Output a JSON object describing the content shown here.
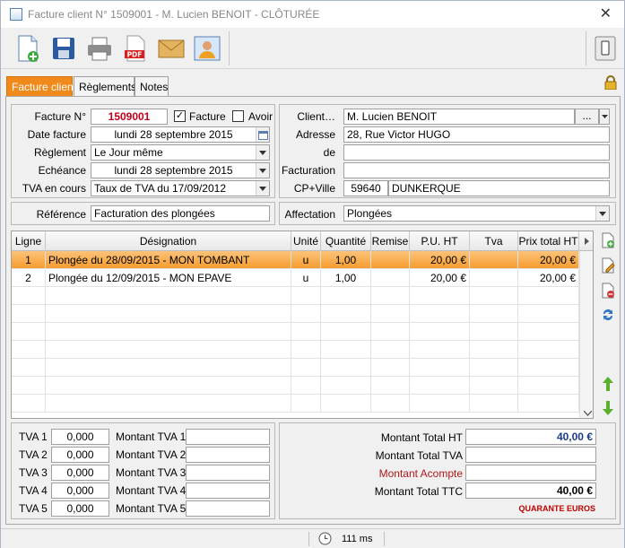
{
  "window": {
    "title": "Facture client N° 1509001 - M. Lucien BENOIT - CLÔTURÉE",
    "close_glyph": "✕"
  },
  "toolbar": {
    "buttons": [
      "new-document-icon",
      "save-icon",
      "print-icon",
      "pdf-icon",
      "email-icon",
      "contact-icon"
    ],
    "pdf_label": "PDF"
  },
  "tabs": [
    {
      "label": "Facture client",
      "active": true
    },
    {
      "label": "Règlements",
      "active": false
    },
    {
      "label": "Notes",
      "active": false
    }
  ],
  "invoice": {
    "number_label": "Facture N°",
    "number": "1509001",
    "facture_label": "Facture",
    "facture_checked": true,
    "avoir_label": "Avoir",
    "avoir_checked": false,
    "date_label": "Date facture",
    "date": "lundi 28 septembre 2015",
    "reglement_label": "Règlement",
    "reglement": "Le Jour même",
    "echeance_label": "Echéance",
    "echeance": "lundi 28 septembre 2015",
    "tva_label": "TVA en cours",
    "tva": "Taux de TVA du 17/09/2012",
    "reference_label": "Référence",
    "reference": "Facturation des plongées"
  },
  "client": {
    "client_label": "Client…",
    "client": "M. Lucien BENOIT",
    "more_button": "...",
    "adresse_label": "Adresse",
    "adresse": "28, Rue Victor HUGO",
    "de_label": "de",
    "de": "",
    "facturation_label": "Facturation",
    "facturation": "",
    "cpville_label": "CP+Ville",
    "cp": "59640",
    "ville": "DUNKERQUE",
    "affectation_label": "Affectation",
    "affectation": "Plongées"
  },
  "grid": {
    "columns": [
      "Ligne",
      "Désignation",
      "Unité",
      "Quantité",
      "Remise",
      "P.U. HT",
      "Tva",
      "Prix total HT"
    ],
    "rows": [
      [
        "1",
        "Plongée du 28/09/2015 - MON TOMBANT",
        "u",
        "1,00",
        "",
        "20,00 €",
        "",
        "20,00 €"
      ],
      [
        "2",
        "Plongée du 12/09/2015 - MON EPAVE",
        "u",
        "1,00",
        "",
        "20,00 €",
        "",
        "20,00 €"
      ]
    ],
    "selected_row": 0,
    "empty_rows": 7
  },
  "tva_summary": [
    {
      "label": "TVA 1",
      "rate": "0,000",
      "amount_label": "Montant TVA 1",
      "amount": ""
    },
    {
      "label": "TVA 2",
      "rate": "0,000",
      "amount_label": "Montant TVA 2",
      "amount": ""
    },
    {
      "label": "TVA 3",
      "rate": "0,000",
      "amount_label": "Montant TVA 3",
      "amount": ""
    },
    {
      "label": "TVA 4",
      "rate": "0,000",
      "amount_label": "Montant TVA 4",
      "amount": ""
    },
    {
      "label": "TVA 5",
      "rate": "0,000",
      "amount_label": "Montant TVA 5",
      "amount": ""
    }
  ],
  "totals": {
    "ht_label": "Montant Total HT",
    "ht": "40,00 €",
    "tva_label": "Montant Total TVA",
    "tva": "",
    "acompte_label": "Montant Acompte",
    "acompte": "",
    "ttc_label": "Montant Total TTC",
    "ttc": "40,00 €",
    "in_words": "QUARANTE EUROS"
  },
  "status": {
    "timer": "111 ms"
  },
  "colors": {
    "accent": "#f08a1a",
    "invoice_number": "#c0001a",
    "total_ht": "#1a3c8c",
    "acompte": "#b01818",
    "in_words": "#c00000"
  }
}
